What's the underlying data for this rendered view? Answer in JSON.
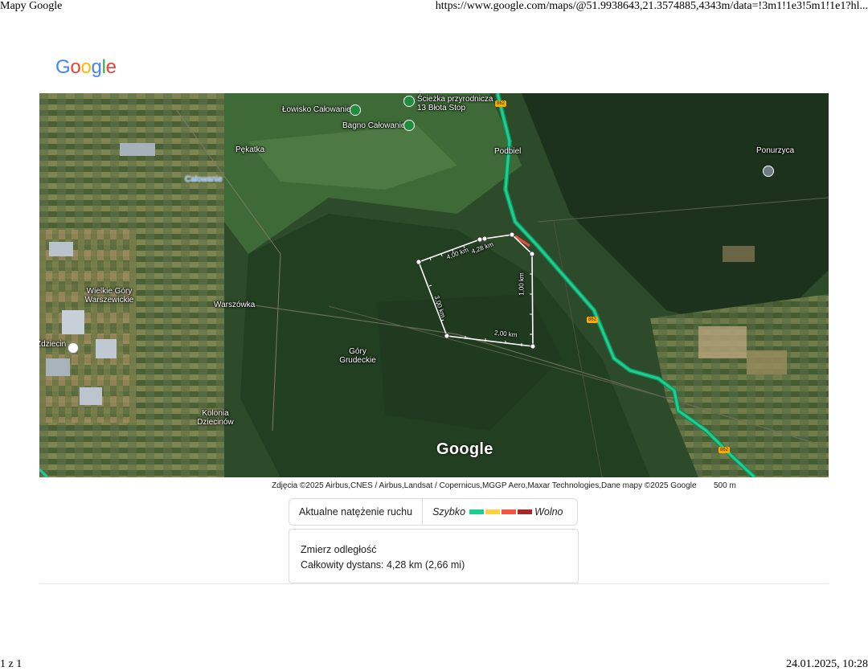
{
  "print_header": {
    "title": "Mapy Google",
    "url": "https://www.google.com/maps/@51.9938643,21.3574885,4343m/data=!3m1!1e3!5m1!1e1?hl..."
  },
  "print_footer": {
    "page": "1 z 1",
    "datetime": "24.01.2025, 10:28"
  },
  "logo": {
    "letters": [
      "G",
      "o",
      "o",
      "g",
      "l",
      "e"
    ],
    "colors": [
      "#4285F4",
      "#EA4335",
      "#FBBC05",
      "#4285F4",
      "#34A853",
      "#EA4335"
    ]
  },
  "map": {
    "view": "satellite",
    "watermark": "Google",
    "places": {
      "lowisko": "Łowisko Całowanie",
      "sciezka": "Ścieżka przyrodnicza 13 Błota Stop",
      "bagno": "Bagno Całowanie",
      "pekatka": "Pękatka",
      "podbiel": "Podbiel",
      "ponurzyca": "Ponurzyca",
      "calowanie": "Całowanie",
      "wielkie_gory": "Wielkie Góry Warszewickie",
      "warszowka": "Warszówka",
      "gory_grudeckie": "Góry Grudeckie",
      "zdziecin": "Zdziecin",
      "kolonia": "Kolonia Dziecinów"
    },
    "road_shields": [
      "862",
      "862",
      "862"
    ],
    "measurement": {
      "segment_labels": [
        "4,00 km",
        "4,28 km",
        "1,00 km",
        "2,00 km",
        "3,00 km"
      ],
      "line_color": "#ffffff"
    },
    "route_color": "#1ccf8f"
  },
  "attribution": "Zdjęcia ©2025 Airbus,CNES / Airbus,Landsat / Copernicus,MGGP Aero,Maxar Technologies,Dane mapy ©2025 Google",
  "scale_label": "500 m",
  "traffic": {
    "label": "Aktualne natężenie ruchu",
    "fast": "Szybko",
    "slow": "Wolno",
    "colors": [
      "#1ccf8f",
      "#ffcf44",
      "#f2563f",
      "#a52a2a"
    ]
  },
  "measure": {
    "title": "Zmierz odległość",
    "total": "Całkowity dystans: 4,28 km (2,66 mi)"
  }
}
